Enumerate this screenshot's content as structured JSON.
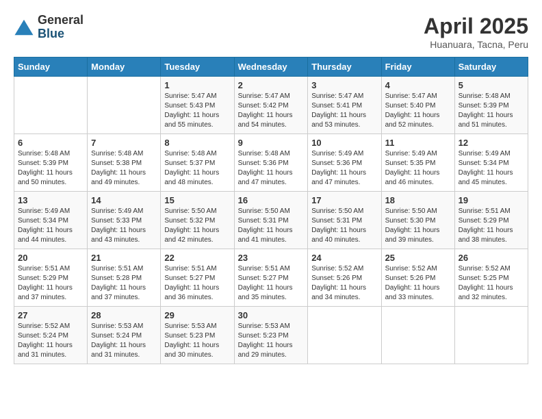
{
  "header": {
    "logo_general": "General",
    "logo_blue": "Blue",
    "month_title": "April 2025",
    "subtitle": "Huanuara, Tacna, Peru"
  },
  "weekdays": [
    "Sunday",
    "Monday",
    "Tuesday",
    "Wednesday",
    "Thursday",
    "Friday",
    "Saturday"
  ],
  "weeks": [
    [
      {
        "day": "",
        "info": ""
      },
      {
        "day": "",
        "info": ""
      },
      {
        "day": "1",
        "info": "Sunrise: 5:47 AM\nSunset: 5:43 PM\nDaylight: 11 hours and 55 minutes."
      },
      {
        "day": "2",
        "info": "Sunrise: 5:47 AM\nSunset: 5:42 PM\nDaylight: 11 hours and 54 minutes."
      },
      {
        "day": "3",
        "info": "Sunrise: 5:47 AM\nSunset: 5:41 PM\nDaylight: 11 hours and 53 minutes."
      },
      {
        "day": "4",
        "info": "Sunrise: 5:47 AM\nSunset: 5:40 PM\nDaylight: 11 hours and 52 minutes."
      },
      {
        "day": "5",
        "info": "Sunrise: 5:48 AM\nSunset: 5:39 PM\nDaylight: 11 hours and 51 minutes."
      }
    ],
    [
      {
        "day": "6",
        "info": "Sunrise: 5:48 AM\nSunset: 5:39 PM\nDaylight: 11 hours and 50 minutes."
      },
      {
        "day": "7",
        "info": "Sunrise: 5:48 AM\nSunset: 5:38 PM\nDaylight: 11 hours and 49 minutes."
      },
      {
        "day": "8",
        "info": "Sunrise: 5:48 AM\nSunset: 5:37 PM\nDaylight: 11 hours and 48 minutes."
      },
      {
        "day": "9",
        "info": "Sunrise: 5:48 AM\nSunset: 5:36 PM\nDaylight: 11 hours and 47 minutes."
      },
      {
        "day": "10",
        "info": "Sunrise: 5:49 AM\nSunset: 5:36 PM\nDaylight: 11 hours and 47 minutes."
      },
      {
        "day": "11",
        "info": "Sunrise: 5:49 AM\nSunset: 5:35 PM\nDaylight: 11 hours and 46 minutes."
      },
      {
        "day": "12",
        "info": "Sunrise: 5:49 AM\nSunset: 5:34 PM\nDaylight: 11 hours and 45 minutes."
      }
    ],
    [
      {
        "day": "13",
        "info": "Sunrise: 5:49 AM\nSunset: 5:34 PM\nDaylight: 11 hours and 44 minutes."
      },
      {
        "day": "14",
        "info": "Sunrise: 5:49 AM\nSunset: 5:33 PM\nDaylight: 11 hours and 43 minutes."
      },
      {
        "day": "15",
        "info": "Sunrise: 5:50 AM\nSunset: 5:32 PM\nDaylight: 11 hours and 42 minutes."
      },
      {
        "day": "16",
        "info": "Sunrise: 5:50 AM\nSunset: 5:31 PM\nDaylight: 11 hours and 41 minutes."
      },
      {
        "day": "17",
        "info": "Sunrise: 5:50 AM\nSunset: 5:31 PM\nDaylight: 11 hours and 40 minutes."
      },
      {
        "day": "18",
        "info": "Sunrise: 5:50 AM\nSunset: 5:30 PM\nDaylight: 11 hours and 39 minutes."
      },
      {
        "day": "19",
        "info": "Sunrise: 5:51 AM\nSunset: 5:29 PM\nDaylight: 11 hours and 38 minutes."
      }
    ],
    [
      {
        "day": "20",
        "info": "Sunrise: 5:51 AM\nSunset: 5:29 PM\nDaylight: 11 hours and 37 minutes."
      },
      {
        "day": "21",
        "info": "Sunrise: 5:51 AM\nSunset: 5:28 PM\nDaylight: 11 hours and 37 minutes."
      },
      {
        "day": "22",
        "info": "Sunrise: 5:51 AM\nSunset: 5:27 PM\nDaylight: 11 hours and 36 minutes."
      },
      {
        "day": "23",
        "info": "Sunrise: 5:51 AM\nSunset: 5:27 PM\nDaylight: 11 hours and 35 minutes."
      },
      {
        "day": "24",
        "info": "Sunrise: 5:52 AM\nSunset: 5:26 PM\nDaylight: 11 hours and 34 minutes."
      },
      {
        "day": "25",
        "info": "Sunrise: 5:52 AM\nSunset: 5:26 PM\nDaylight: 11 hours and 33 minutes."
      },
      {
        "day": "26",
        "info": "Sunrise: 5:52 AM\nSunset: 5:25 PM\nDaylight: 11 hours and 32 minutes."
      }
    ],
    [
      {
        "day": "27",
        "info": "Sunrise: 5:52 AM\nSunset: 5:24 PM\nDaylight: 11 hours and 31 minutes."
      },
      {
        "day": "28",
        "info": "Sunrise: 5:53 AM\nSunset: 5:24 PM\nDaylight: 11 hours and 31 minutes."
      },
      {
        "day": "29",
        "info": "Sunrise: 5:53 AM\nSunset: 5:23 PM\nDaylight: 11 hours and 30 minutes."
      },
      {
        "day": "30",
        "info": "Sunrise: 5:53 AM\nSunset: 5:23 PM\nDaylight: 11 hours and 29 minutes."
      },
      {
        "day": "",
        "info": ""
      },
      {
        "day": "",
        "info": ""
      },
      {
        "day": "",
        "info": ""
      }
    ]
  ]
}
